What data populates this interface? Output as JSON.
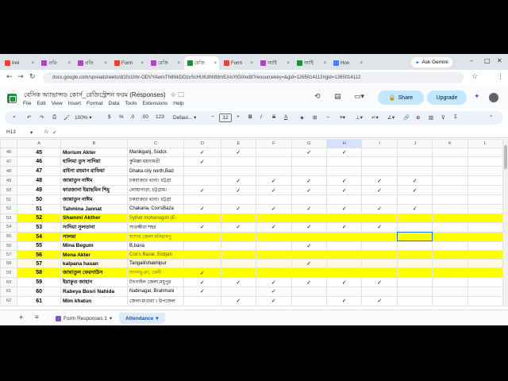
{
  "browser": {
    "tabs": [
      {
        "label": "Invi",
        "color": "#ea4335",
        "active": false
      },
      {
        "label": "প্রতি",
        "color": "#ab47bc",
        "active": false
      },
      {
        "label": "প্রতি",
        "color": "#ab47bc",
        "active": false
      },
      {
        "label": "Form",
        "color": "#ea4335",
        "active": false
      },
      {
        "label": "রেজি",
        "color": "#ab47bc",
        "active": false
      },
      {
        "label": "রেজি",
        "color": "#1e8e3e",
        "active": true
      },
      {
        "label": "Form",
        "color": "#ea4335",
        "active": false
      },
      {
        "label": "আইি",
        "color": "#ab47bc",
        "active": false
      },
      {
        "label": "আইি",
        "color": "#1e8e3e",
        "active": false
      },
      {
        "label": "Hon",
        "color": "#4285f4",
        "active": false
      }
    ],
    "ask_gemini": "Ask Gemini",
    "url": "docs.google.com/spreadsheets/d/1fo1hhr-ODVYAwmTh8NkDOzvScHUKdhNfdmEAIsYlG0/edit?resourcekey=&gid=1265014112#gid=1265014112"
  },
  "sheets": {
    "doc_title": "বেসিক অ্যাভান্সড কোর্স_রেজিস্ট্রেশন ফরম (Responses)",
    "menus": [
      "File",
      "Edit",
      "View",
      "Insert",
      "Format",
      "Data",
      "Tools",
      "Extensions",
      "Help"
    ],
    "share_label": "Share",
    "upgrade_label": "Upgrade",
    "toolbar": {
      "zoom": "100%",
      "currency": "$",
      "percent": "%",
      "dec_dec": ".0",
      "dec_inc": ".00",
      "number_format": "123",
      "font": "Defaul...",
      "font_size": "12",
      "bold": "B",
      "italic": "I",
      "strike": "S",
      "text_color": "A"
    },
    "name_box": "H13",
    "formula_value": "✓",
    "columns": [
      "A",
      "B",
      "C",
      "D",
      "E",
      "F",
      "G",
      "H",
      "I",
      "J",
      "K",
      "L"
    ],
    "selected_column": "H",
    "rows": [
      {
        "row": "46",
        "num": "45",
        "name": "Morium Akter",
        "addr": "Manikganj, Sodor.",
        "checks": [
          "✓",
          "✓",
          "",
          "✓",
          "✓",
          "",
          "",
          ""
        ],
        "style": ""
      },
      {
        "row": "47",
        "num": "46",
        "name": "হালিমা তুস সাদিয়া",
        "addr": "কুমিল্লা ময়নামতী",
        "checks": [
          "✓",
          "",
          "",
          "",
          "",
          "",
          "",
          ""
        ],
        "style": ""
      },
      {
        "row": "48",
        "num": "47",
        "name": "রাইসা রহমান রাফিয়া",
        "addr": "Dhaka city north,Bad",
        "checks": [
          "",
          "",
          "",
          "",
          "",
          "",
          "",
          ""
        ],
        "style": ""
      },
      {
        "row": "49",
        "num": "48",
        "name": "জান্নাতুন নাঈম",
        "addr": "চকবাজার থানা। চট্টগ্রা",
        "checks": [
          "",
          "✓",
          "✓",
          "✓",
          "✓",
          "✓",
          "✓",
          ""
        ],
        "style": ""
      },
      {
        "row": "50",
        "num": "49",
        "name": "ফারজানা ইয়াছমিন শিমু",
        "addr": "লোহাগাড়া, চট্টগ্রাম।",
        "checks": [
          "✓",
          "✓",
          "✓",
          "✓",
          "✓",
          "✓",
          "✓",
          ""
        ],
        "style": ""
      },
      {
        "row": "51",
        "num": "50",
        "name": "জান্নাতুন নাঈম",
        "addr": "চকবাজার থানা। চট্টগ্রা",
        "checks": [
          "",
          "",
          "",
          "",
          "",
          "",
          "",
          ""
        ],
        "style": ""
      },
      {
        "row": "52",
        "num": "51",
        "name": "Tahmina Jannat",
        "addr": "Chakaria, Cox'sBaza",
        "checks": [
          "✓",
          "✓",
          "✓",
          "✓",
          "✓",
          "✓",
          "✓",
          ""
        ],
        "style": ""
      },
      {
        "row": "53",
        "num": "52",
        "name": "Shammi Akther",
        "addr": "Sylhet mohanogori (E",
        "checks": [
          "",
          "",
          "",
          "",
          "",
          "",
          "",
          ""
        ],
        "style": "yellow"
      },
      {
        "row": "54",
        "num": "53",
        "name": "সাদিয়া সুলতানা",
        "addr": "সাতক্ষীরা শহর",
        "checks": [
          "✓",
          "✓",
          "✓",
          "✓",
          "✓",
          "✓",
          "",
          ""
        ],
        "style": ""
      },
      {
        "row": "55",
        "num": "54",
        "name": "সালমা",
        "addr": "যশোর জেলা মনিরামপু",
        "checks": [
          "",
          "",
          "",
          "",
          "",
          "",
          "",
          ""
        ],
        "style": "yellow"
      },
      {
        "row": "56",
        "num": "55",
        "name": "Mina Begum",
        "addr": "B,baria",
        "checks": [
          "",
          "",
          "",
          "✓",
          "",
          "",
          "",
          ""
        ],
        "style": ""
      },
      {
        "row": "57",
        "num": "56",
        "name": "Mena Akter",
        "addr": "Cox's Bazar, Eidgah",
        "checks": [
          "",
          "",
          "",
          "",
          "",
          "",
          "",
          ""
        ],
        "style": "yellow"
      },
      {
        "row": "58",
        "num": "57",
        "name": "kalpana hasan",
        "addr": "Tangail/shakhipur",
        "checks": [
          "",
          "",
          "",
          "✓",
          "",
          "",
          "",
          ""
        ],
        "style": "cream"
      },
      {
        "row": "59",
        "num": "58",
        "name": "জান্নাতুল ফেরদাউস",
        "addr": "দাগনভূঞা, ফেনী",
        "checks": [
          "✓",
          "",
          "",
          "",
          "",
          "",
          "",
          ""
        ],
        "style": "yellow"
      },
      {
        "row": "60",
        "num": "59",
        "name": "ইয়াকুত জাহান",
        "addr": "টাংগাইল জেলা,মধুপুর",
        "checks": [
          "✓",
          "✓",
          "✓",
          "✓",
          "✓",
          "✓",
          "",
          ""
        ],
        "style": ""
      },
      {
        "row": "61",
        "num": "60",
        "name": "Rabeya Bosri Nahida",
        "addr": "Nabinagar, Brahmani",
        "checks": [
          "✓",
          "",
          "✓",
          "",
          "",
          "",
          "",
          ""
        ],
        "style": ""
      },
      {
        "row": "62",
        "num": "61",
        "name": "Mim khatun",
        "addr": "জেলা মাগুরা । উপজেল",
        "checks": [
          "",
          "✓",
          "✓",
          "",
          "✓",
          "✓",
          "",
          ""
        ],
        "style": ""
      }
    ],
    "sheet_tabs": [
      {
        "label": "Form Responses 1",
        "active": false
      },
      {
        "label": "Attendance",
        "active": true
      }
    ]
  }
}
